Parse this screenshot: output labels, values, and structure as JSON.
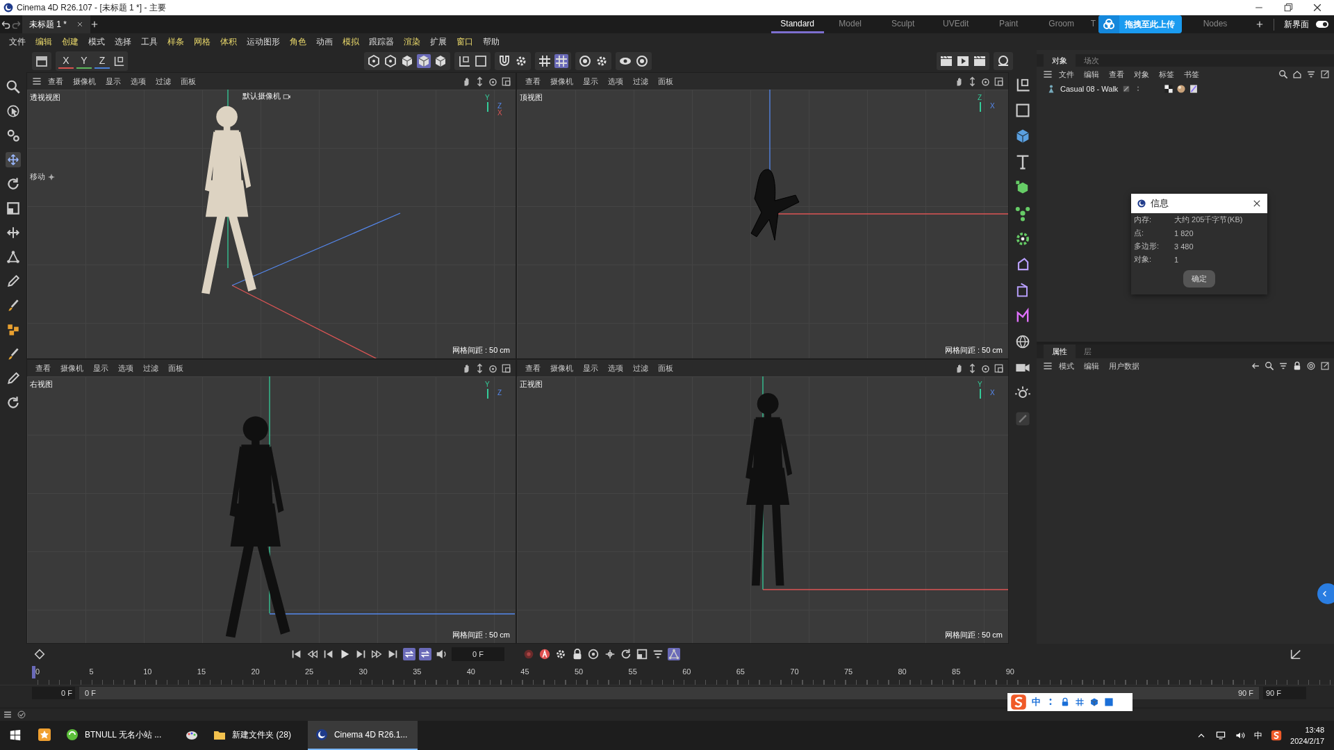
{
  "window": {
    "title": "Cinema 4D R26.107 - [未标题 1 *] - 主要"
  },
  "document_tabs": [
    {
      "label": "未标题 1 *",
      "selected": true
    }
  ],
  "layouts": [
    {
      "label": "Standard",
      "selected": true
    },
    {
      "label": "Model",
      "selected": false
    },
    {
      "label": "Sculpt",
      "selected": false
    },
    {
      "label": "UVEdit",
      "selected": false
    },
    {
      "label": "Paint",
      "selected": false
    },
    {
      "label": "Groom",
      "selected": false
    },
    {
      "label": "T",
      "selected": false
    },
    {
      "label": "Nodes",
      "selected": false
    }
  ],
  "upload_button": {
    "label": "拖拽至此上传"
  },
  "new_ui": {
    "label": "新界面",
    "on": true
  },
  "menu": [
    {
      "label": "文件",
      "highlighted": false
    },
    {
      "label": "编辑",
      "highlighted": true
    },
    {
      "label": "创建",
      "highlighted": true
    },
    {
      "label": "模式",
      "highlighted": false
    },
    {
      "label": "选择",
      "highlighted": false
    },
    {
      "label": "工具",
      "highlighted": false
    },
    {
      "label": "样条",
      "highlighted": true
    },
    {
      "label": "网格",
      "highlighted": true
    },
    {
      "label": "体积",
      "highlighted": true
    },
    {
      "label": "运动图形",
      "highlighted": false
    },
    {
      "label": "角色",
      "highlighted": true
    },
    {
      "label": "动画",
      "highlighted": false
    },
    {
      "label": "模拟",
      "highlighted": true
    },
    {
      "label": "跟踪器",
      "highlighted": false
    },
    {
      "label": "渲染",
      "highlighted": true
    },
    {
      "label": "扩展",
      "highlighted": false
    },
    {
      "label": "窗口",
      "highlighted": true
    },
    {
      "label": "帮助",
      "highlighted": false
    }
  ],
  "axis_buttons": [
    {
      "label": "X",
      "color": "#d9534f"
    },
    {
      "label": "Y",
      "color": "#5cb85c"
    },
    {
      "label": "Z",
      "color": "#4a80d9"
    }
  ],
  "viewports": [
    {
      "kind": "perspective",
      "label": "透视视图",
      "camera": "默认摄像机",
      "tool_hint": "移动",
      "menu": [
        "查看",
        "摄像机",
        "显示",
        "选项",
        "过滤",
        "面板"
      ],
      "grid_note": "网格间距 : 50 cm",
      "axes": [
        "Y",
        "Z",
        "X"
      ]
    },
    {
      "kind": "top",
      "label": "顶视图",
      "menu": [
        "查看",
        "摄像机",
        "显示",
        "选项",
        "过滤",
        "面板"
      ],
      "grid_note": "网格间距 : 50 cm",
      "axes": [
        "Z",
        "X"
      ]
    },
    {
      "kind": "right",
      "label": "右视图",
      "menu": [
        "查看",
        "摄像机",
        "显示",
        "选项",
        "过滤",
        "面板"
      ],
      "grid_note": "网格间距 : 50 cm",
      "axes": [
        "Y",
        "Z"
      ]
    },
    {
      "kind": "front",
      "label": "正视图",
      "menu": [
        "查看",
        "摄像机",
        "显示",
        "选项",
        "过滤",
        "面板"
      ],
      "grid_note": "网格间距 : 50 cm",
      "axes": [
        "Y",
        "X"
      ]
    }
  ],
  "object_manager": {
    "tabs": [
      {
        "label": "对象",
        "selected": true
      },
      {
        "label": "场次",
        "selected": false
      }
    ],
    "menu": [
      "文件",
      "编辑",
      "查看",
      "对象",
      "标签",
      "书签"
    ],
    "objects": [
      {
        "name": "Casual 08 - Walk"
      }
    ]
  },
  "info_dialog": {
    "title": "信息",
    "rows": [
      {
        "label": "内存:",
        "value": "大约 205千字节(KB)"
      },
      {
        "label": "点:",
        "value": "1 820"
      },
      {
        "label": "多边形:",
        "value": "3 480"
      },
      {
        "label": "对象:",
        "value": "1"
      }
    ],
    "ok_button": "确定"
  },
  "attributes": {
    "tabs": [
      {
        "label": "属性",
        "selected": true
      },
      {
        "label": "层",
        "selected": false
      }
    ],
    "menu": [
      "模式",
      "编辑",
      "用户数据"
    ]
  },
  "timeline": {
    "frame_field": "0 F",
    "ruler": [
      "0",
      "5",
      "10",
      "15",
      "20",
      "25",
      "30",
      "35",
      "40",
      "45",
      "50",
      "55",
      "60",
      "65",
      "70",
      "75",
      "80",
      "85",
      "90"
    ],
    "start_field": "0 F",
    "bar_start": "0 F",
    "bar_end": "90 F",
    "end_field": "90 F"
  },
  "ime_bar": {
    "mode": "中"
  },
  "taskbar": {
    "items": [
      {
        "label": "BTNULL 无名小站 ...",
        "kind": "app",
        "selected": false
      },
      {
        "kind": "paint",
        "selected": false
      },
      {
        "label": "新建文件夹 (28)",
        "kind": "folder",
        "selected": false
      },
      {
        "label": "Cinema 4D R26.1...",
        "kind": "cinema",
        "selected": true
      }
    ],
    "input_language": "中",
    "time": "13:48",
    "date": "2024/2/17"
  }
}
